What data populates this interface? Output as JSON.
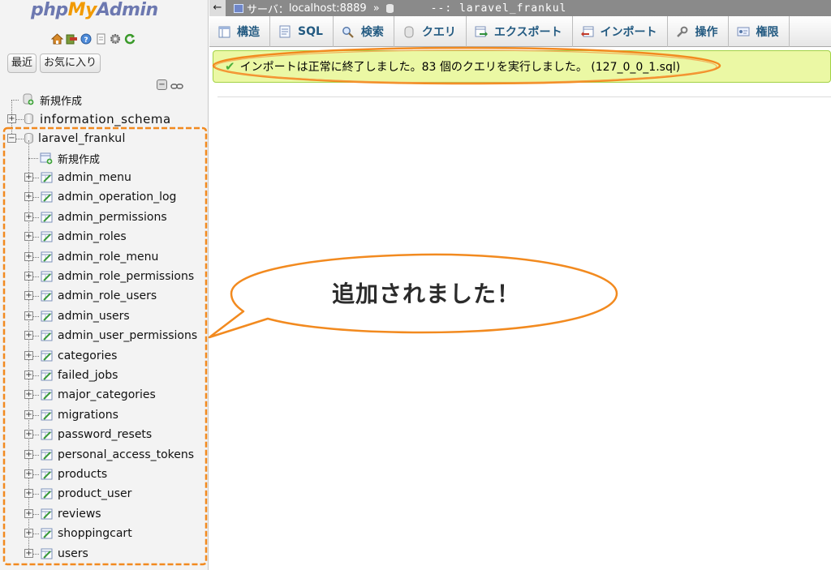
{
  "app": {
    "logo": {
      "php": "php",
      "my": "My",
      "admin": "Admin"
    },
    "quick_icons": [
      "home-icon",
      "exit-icon",
      "help-icon",
      "docs-icon",
      "settings-icon",
      "reload-icon"
    ]
  },
  "sidebar": {
    "tabs": [
      "最近",
      "お気に入り"
    ],
    "tree": {
      "new_label": "新規作成",
      "databases": [
        "information_schema",
        "laravel_frankul"
      ],
      "active_db_new": "新規作成",
      "tables": [
        "admin_menu",
        "admin_operation_log",
        "admin_permissions",
        "admin_roles",
        "admin_role_menu",
        "admin_role_permissions",
        "admin_role_users",
        "admin_users",
        "admin_user_permissions",
        "categories",
        "failed_jobs",
        "major_categories",
        "migrations",
        "password_resets",
        "personal_access_tokens",
        "products",
        "product_user",
        "reviews",
        "shoppingcart",
        "users"
      ]
    }
  },
  "topbar": {
    "back": "←",
    "server_label": "サーバ：",
    "server": "localhost:8889",
    "sep": "»",
    "database": "--: laravel_frankul"
  },
  "toolbar": {
    "items": [
      {
        "label": "構造",
        "icon": "structure-icon"
      },
      {
        "label": "SQL",
        "icon": "sql-icon"
      },
      {
        "label": "検索",
        "icon": "search-icon"
      },
      {
        "label": "クエリ",
        "icon": "query-icon"
      },
      {
        "label": "エクスポート",
        "icon": "export-icon"
      },
      {
        "label": "インポート",
        "icon": "import-icon"
      },
      {
        "label": "操作",
        "icon": "wrench-icon"
      },
      {
        "label": "権限",
        "icon": "privileges-icon"
      }
    ]
  },
  "message": {
    "icon": "check-icon",
    "text": "インポートは正常に終了しました。83 個のクエリを実行しました。 (127_0_0_1.sql)"
  },
  "annotation": {
    "callout": "追加されました！",
    "color": "#f28a1f"
  }
}
